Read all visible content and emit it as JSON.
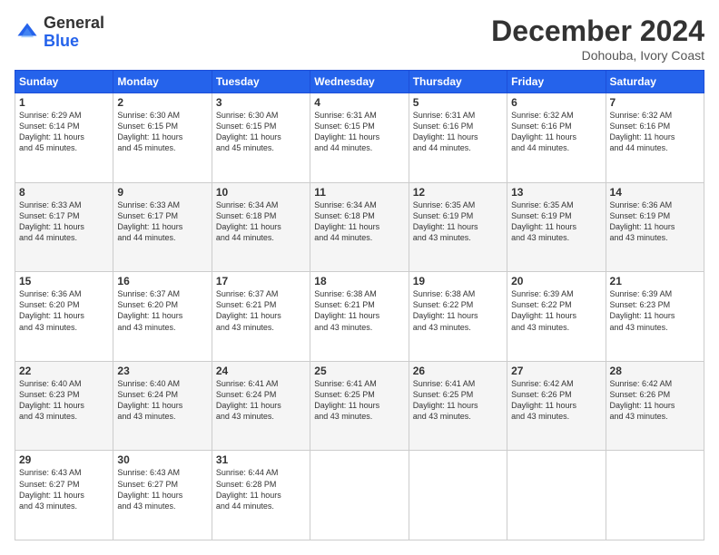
{
  "header": {
    "logo_general": "General",
    "logo_blue": "Blue",
    "title": "December 2024",
    "location": "Dohouba, Ivory Coast"
  },
  "weekdays": [
    "Sunday",
    "Monday",
    "Tuesday",
    "Wednesday",
    "Thursday",
    "Friday",
    "Saturday"
  ],
  "weeks": [
    [
      {
        "day": "1",
        "text": "Sunrise: 6:29 AM\nSunset: 6:14 PM\nDaylight: 11 hours\nand 45 minutes."
      },
      {
        "day": "2",
        "text": "Sunrise: 6:30 AM\nSunset: 6:15 PM\nDaylight: 11 hours\nand 45 minutes."
      },
      {
        "day": "3",
        "text": "Sunrise: 6:30 AM\nSunset: 6:15 PM\nDaylight: 11 hours\nand 45 minutes."
      },
      {
        "day": "4",
        "text": "Sunrise: 6:31 AM\nSunset: 6:15 PM\nDaylight: 11 hours\nand 44 minutes."
      },
      {
        "day": "5",
        "text": "Sunrise: 6:31 AM\nSunset: 6:16 PM\nDaylight: 11 hours\nand 44 minutes."
      },
      {
        "day": "6",
        "text": "Sunrise: 6:32 AM\nSunset: 6:16 PM\nDaylight: 11 hours\nand 44 minutes."
      },
      {
        "day": "7",
        "text": "Sunrise: 6:32 AM\nSunset: 6:16 PM\nDaylight: 11 hours\nand 44 minutes."
      }
    ],
    [
      {
        "day": "8",
        "text": "Sunrise: 6:33 AM\nSunset: 6:17 PM\nDaylight: 11 hours\nand 44 minutes."
      },
      {
        "day": "9",
        "text": "Sunrise: 6:33 AM\nSunset: 6:17 PM\nDaylight: 11 hours\nand 44 minutes."
      },
      {
        "day": "10",
        "text": "Sunrise: 6:34 AM\nSunset: 6:18 PM\nDaylight: 11 hours\nand 44 minutes."
      },
      {
        "day": "11",
        "text": "Sunrise: 6:34 AM\nSunset: 6:18 PM\nDaylight: 11 hours\nand 44 minutes."
      },
      {
        "day": "12",
        "text": "Sunrise: 6:35 AM\nSunset: 6:19 PM\nDaylight: 11 hours\nand 43 minutes."
      },
      {
        "day": "13",
        "text": "Sunrise: 6:35 AM\nSunset: 6:19 PM\nDaylight: 11 hours\nand 43 minutes."
      },
      {
        "day": "14",
        "text": "Sunrise: 6:36 AM\nSunset: 6:19 PM\nDaylight: 11 hours\nand 43 minutes."
      }
    ],
    [
      {
        "day": "15",
        "text": "Sunrise: 6:36 AM\nSunset: 6:20 PM\nDaylight: 11 hours\nand 43 minutes."
      },
      {
        "day": "16",
        "text": "Sunrise: 6:37 AM\nSunset: 6:20 PM\nDaylight: 11 hours\nand 43 minutes."
      },
      {
        "day": "17",
        "text": "Sunrise: 6:37 AM\nSunset: 6:21 PM\nDaylight: 11 hours\nand 43 minutes."
      },
      {
        "day": "18",
        "text": "Sunrise: 6:38 AM\nSunset: 6:21 PM\nDaylight: 11 hours\nand 43 minutes."
      },
      {
        "day": "19",
        "text": "Sunrise: 6:38 AM\nSunset: 6:22 PM\nDaylight: 11 hours\nand 43 minutes."
      },
      {
        "day": "20",
        "text": "Sunrise: 6:39 AM\nSunset: 6:22 PM\nDaylight: 11 hours\nand 43 minutes."
      },
      {
        "day": "21",
        "text": "Sunrise: 6:39 AM\nSunset: 6:23 PM\nDaylight: 11 hours\nand 43 minutes."
      }
    ],
    [
      {
        "day": "22",
        "text": "Sunrise: 6:40 AM\nSunset: 6:23 PM\nDaylight: 11 hours\nand 43 minutes."
      },
      {
        "day": "23",
        "text": "Sunrise: 6:40 AM\nSunset: 6:24 PM\nDaylight: 11 hours\nand 43 minutes."
      },
      {
        "day": "24",
        "text": "Sunrise: 6:41 AM\nSunset: 6:24 PM\nDaylight: 11 hours\nand 43 minutes."
      },
      {
        "day": "25",
        "text": "Sunrise: 6:41 AM\nSunset: 6:25 PM\nDaylight: 11 hours\nand 43 minutes."
      },
      {
        "day": "26",
        "text": "Sunrise: 6:41 AM\nSunset: 6:25 PM\nDaylight: 11 hours\nand 43 minutes."
      },
      {
        "day": "27",
        "text": "Sunrise: 6:42 AM\nSunset: 6:26 PM\nDaylight: 11 hours\nand 43 minutes."
      },
      {
        "day": "28",
        "text": "Sunrise: 6:42 AM\nSunset: 6:26 PM\nDaylight: 11 hours\nand 43 minutes."
      }
    ],
    [
      {
        "day": "29",
        "text": "Sunrise: 6:43 AM\nSunset: 6:27 PM\nDaylight: 11 hours\nand 43 minutes."
      },
      {
        "day": "30",
        "text": "Sunrise: 6:43 AM\nSunset: 6:27 PM\nDaylight: 11 hours\nand 43 minutes."
      },
      {
        "day": "31",
        "text": "Sunrise: 6:44 AM\nSunset: 6:28 PM\nDaylight: 11 hours\nand 44 minutes."
      },
      {
        "day": "",
        "text": ""
      },
      {
        "day": "",
        "text": ""
      },
      {
        "day": "",
        "text": ""
      },
      {
        "day": "",
        "text": ""
      }
    ]
  ]
}
